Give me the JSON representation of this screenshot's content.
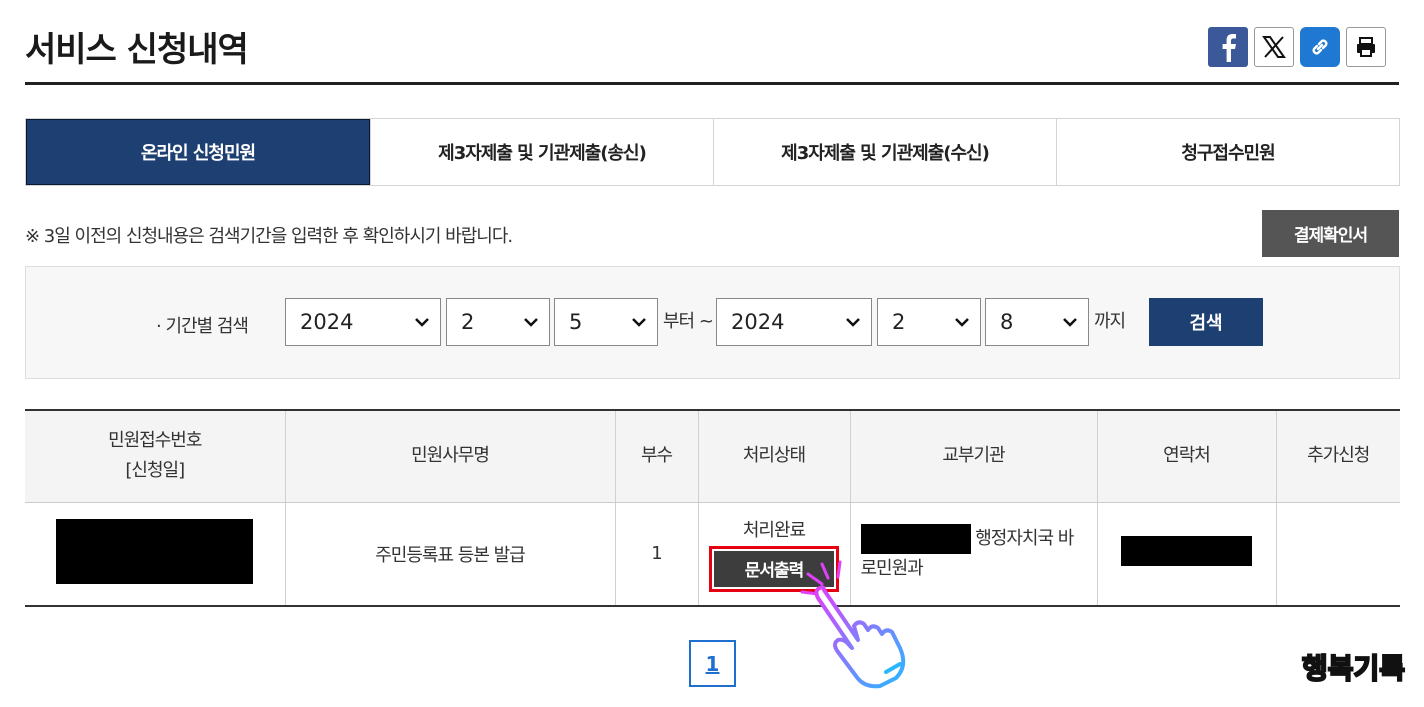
{
  "page": {
    "title": "서비스 신청내역"
  },
  "share": {
    "facebook": "facebook-icon",
    "x": "x-icon",
    "link": "link-icon",
    "print": "print-icon"
  },
  "tabs": [
    {
      "label": "온라인 신청민원",
      "active": true
    },
    {
      "label": "제3자제출 및 기관제출(송신)",
      "active": false
    },
    {
      "label": "제3자제출 및 기관제출(수신)",
      "active": false
    },
    {
      "label": "청구접수민원",
      "active": false
    }
  ],
  "notice": "※ 3일 이전의 신청내용은 검색기간을 입력한 후 확인하시기 바랍니다.",
  "payment_button": "결제확인서",
  "search": {
    "label": "· 기간별 검색",
    "from": {
      "year": "2024",
      "month": "2",
      "day": "5"
    },
    "from_suffix": "부터 ~",
    "to": {
      "year": "2024",
      "month": "2",
      "day": "8"
    },
    "to_suffix": "까지",
    "button": "검색"
  },
  "table": {
    "headers": [
      "민원접수번호",
      "[신청일]",
      "민원사무명",
      "부수",
      "처리상태",
      "교부기관",
      "연락처",
      "추가신청"
    ],
    "rows": [
      {
        "service_name": "주민등록표 등본 발급",
        "copies": "1",
        "status": "처리완료",
        "print_button": "문서출력",
        "org_line1": "행정자치국 바",
        "org_line2": "로민원과"
      }
    ]
  },
  "pagination": {
    "current": "1"
  },
  "watermark": "행복기록",
  "colors": {
    "primary": "#1e3f72",
    "highlight": "#e60012",
    "link": "#1f6fd1"
  }
}
